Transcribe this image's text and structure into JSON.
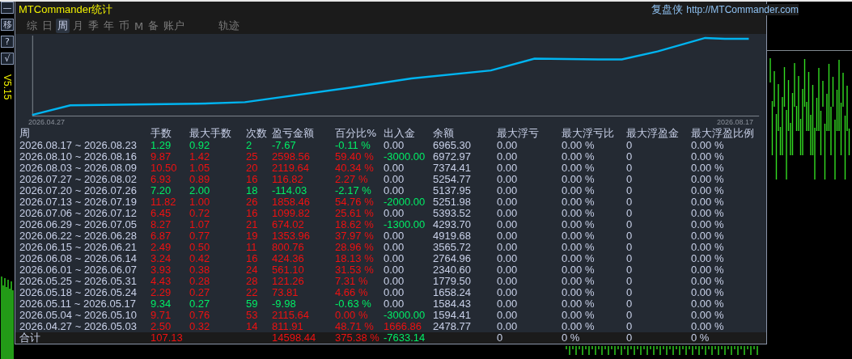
{
  "window": {
    "title": "MTCommander统计",
    "brand": "复盘侠",
    "url": "http://MTCommander.com"
  },
  "side_buttons": [
    "—",
    "移",
    "?",
    "√"
  ],
  "version": "V5.15",
  "tabs": [
    {
      "label": "综",
      "selected": false
    },
    {
      "label": "日",
      "selected": false
    },
    {
      "label": "周",
      "selected": true
    },
    {
      "label": "月",
      "selected": false
    },
    {
      "label": "季",
      "selected": false
    },
    {
      "label": "年",
      "selected": false
    },
    {
      "label": "币",
      "selected": false
    },
    {
      "label": "M",
      "selected": false
    },
    {
      "label": "备",
      "selected": false
    },
    {
      "label": "账户",
      "selected": false
    },
    {
      "label": "轨迹",
      "selected": false
    }
  ],
  "chart": {
    "start_label": "2026.04.27",
    "end_label": "2026.08.17"
  },
  "table": {
    "columns": [
      "周",
      "手数",
      "最大手数",
      "次数",
      "盈亏金额",
      "百分比%",
      "出入金",
      "余额",
      "最大浮亏",
      "最大浮亏比",
      "最大浮盈金",
      "最大浮盈比例"
    ],
    "rows": [
      {
        "color": "#00ee66",
        "cells": [
          "2026.08.17 ~ 2026.08.23",
          "1.29",
          "0.92",
          "2",
          "-7.67",
          "-0.11 %"
        ],
        "cash_flow": {
          "text": "0.00",
          "color": "#c8d0e8"
        },
        "cells_after": [
          "6965.30",
          "0.00",
          "0.00 %",
          "0",
          "0.00 %"
        ]
      },
      {
        "color": "#ee1111",
        "cells": [
          "2026.08.10 ~ 2026.08.16",
          "9.87",
          "1.42",
          "25",
          "2598.56",
          "59.40 %"
        ],
        "cash_flow": {
          "text": "-3000.00",
          "color": "#00ee66"
        },
        "cells_after": [
          "6972.97",
          "0.00",
          "0.00 %",
          "0",
          "0.00 %"
        ]
      },
      {
        "color": "#ee1111",
        "cells": [
          "2026.08.03 ~ 2026.08.09",
          "10.50",
          "1.05",
          "20",
          "2119.64",
          "40.34 %"
        ],
        "cash_flow": {
          "text": "0.00",
          "color": "#c8d0e8"
        },
        "cells_after": [
          "7374.41",
          "0.00",
          "0.00 %",
          "0",
          "0.00 %"
        ]
      },
      {
        "color": "#ee1111",
        "cells": [
          "2026.07.27 ~ 2026.08.02",
          "6.93",
          "0.89",
          "16",
          "116.82",
          "2.27 %"
        ],
        "cash_flow": {
          "text": "0.00",
          "color": "#c8d0e8"
        },
        "cells_after": [
          "5254.77",
          "0.00",
          "0.00 %",
          "0",
          "0.00 %"
        ]
      },
      {
        "color": "#00ee66",
        "cells": [
          "2026.07.20 ~ 2026.07.26",
          "7.20",
          "2.00",
          "18",
          "-114.03",
          "-2.17 %"
        ],
        "cash_flow": {
          "text": "0.00",
          "color": "#c8d0e8"
        },
        "cells_after": [
          "5137.95",
          "0.00",
          "0.00 %",
          "0",
          "0.00 %"
        ]
      },
      {
        "color": "#ee1111",
        "cells": [
          "2026.07.13 ~ 2026.07.19",
          "11.82",
          "1.00",
          "26",
          "1858.46",
          "54.76 %"
        ],
        "cash_flow": {
          "text": "-2000.00",
          "color": "#00ee66"
        },
        "cells_after": [
          "5251.98",
          "0.00",
          "0.00 %",
          "0",
          "0.00 %"
        ]
      },
      {
        "color": "#ee1111",
        "cells": [
          "2026.07.06 ~ 2026.07.12",
          "6.45",
          "0.72",
          "16",
          "1099.82",
          "25.61 %"
        ],
        "cash_flow": {
          "text": "0.00",
          "color": "#c8d0e8"
        },
        "cells_after": [
          "5393.52",
          "0.00",
          "0.00 %",
          "0",
          "0.00 %"
        ]
      },
      {
        "color": "#ee1111",
        "cells": [
          "2026.06.29 ~ 2026.07.05",
          "8.27",
          "1.07",
          "21",
          "674.02",
          "18.62 %"
        ],
        "cash_flow": {
          "text": "-1300.00",
          "color": "#00ee66"
        },
        "cells_after": [
          "4293.70",
          "0.00",
          "0.00 %",
          "0",
          "0.00 %"
        ]
      },
      {
        "color": "#ee1111",
        "cells": [
          "2026.06.22 ~ 2026.06.28",
          "6.87",
          "0.77",
          "19",
          "1353.96",
          "37.97 %"
        ],
        "cash_flow": {
          "text": "0.00",
          "color": "#c8d0e8"
        },
        "cells_after": [
          "4919.68",
          "0.00",
          "0.00 %",
          "0",
          "0.00 %"
        ]
      },
      {
        "color": "#ee1111",
        "cells": [
          "2026.06.15 ~ 2026.06.21",
          "2.49",
          "0.50",
          "11",
          "800.76",
          "28.96 %"
        ],
        "cash_flow": {
          "text": "0.00",
          "color": "#c8d0e8"
        },
        "cells_after": [
          "3565.72",
          "0.00",
          "0.00 %",
          "0",
          "0.00 %"
        ]
      },
      {
        "color": "#ee1111",
        "cells": [
          "2026.06.08 ~ 2026.06.14",
          "3.24",
          "0.42",
          "16",
          "424.36",
          "18.13 %"
        ],
        "cash_flow": {
          "text": "0.00",
          "color": "#c8d0e8"
        },
        "cells_after": [
          "2764.96",
          "0.00",
          "0.00 %",
          "0",
          "0.00 %"
        ]
      },
      {
        "color": "#ee1111",
        "cells": [
          "2026.06.01 ~ 2026.06.07",
          "3.93",
          "0.38",
          "24",
          "561.10",
          "31.53 %"
        ],
        "cash_flow": {
          "text": "0.00",
          "color": "#c8d0e8"
        },
        "cells_after": [
          "2340.60",
          "0.00",
          "0.00 %",
          "0",
          "0.00 %"
        ]
      },
      {
        "color": "#ee1111",
        "cells": [
          "2026.05.25 ~ 2026.05.31",
          "4.43",
          "0.28",
          "28",
          "121.26",
          "7.31 %"
        ],
        "cash_flow": {
          "text": "0.00",
          "color": "#c8d0e8"
        },
        "cells_after": [
          "1779.50",
          "0.00",
          "0.00 %",
          "0",
          "0.00 %"
        ]
      },
      {
        "color": "#ee1111",
        "cells": [
          "2026.05.18 ~ 2026.05.24",
          "2.29",
          "0.27",
          "22",
          "73.81",
          "4.66 %"
        ],
        "cash_flow": {
          "text": "0.00",
          "color": "#c8d0e8"
        },
        "cells_after": [
          "1658.24",
          "0.00",
          "0.00 %",
          "0",
          "0.00 %"
        ]
      },
      {
        "color": "#00ee66",
        "cells": [
          "2026.05.11 ~ 2026.05.17",
          "9.34",
          "0.27",
          "59",
          "-9.98",
          "-0.63 %"
        ],
        "cash_flow": {
          "text": "0.00",
          "color": "#c8d0e8"
        },
        "cells_after": [
          "1584.43",
          "0.00",
          "0.00 %",
          "0",
          "0.00 %"
        ]
      },
      {
        "color": "#ee1111",
        "cells": [
          "2026.05.04 ~ 2026.05.10",
          "9.71",
          "0.76",
          "53",
          "2115.64",
          "0.00 %"
        ],
        "cash_flow": {
          "text": "-3000.00",
          "color": "#00ee66"
        },
        "cells_after": [
          "1594.41",
          "0.00",
          "0.00 %",
          "0",
          "0.00 %"
        ]
      },
      {
        "color": "#ee1111",
        "cells": [
          "2026.04.27 ~ 2026.05.03",
          "2.50",
          "0.32",
          "14",
          "811.91",
          "48.71 %"
        ],
        "cash_flow": {
          "text": "1666.86",
          "color": "#ee1111"
        },
        "cells_after": [
          "2478.77",
          "0.00",
          "0.00 %",
          "0",
          "0.00 %"
        ]
      }
    ],
    "total": {
      "label": "合计",
      "color": "#ee1111",
      "lots": "107.13",
      "pnl": "14598.44",
      "percent": "375.38 %",
      "cash_flow": {
        "text": "-7633.14",
        "color": "#00ee66"
      },
      "cells_after": [
        "0",
        "0 %",
        "0",
        "0 %"
      ]
    }
  }
}
